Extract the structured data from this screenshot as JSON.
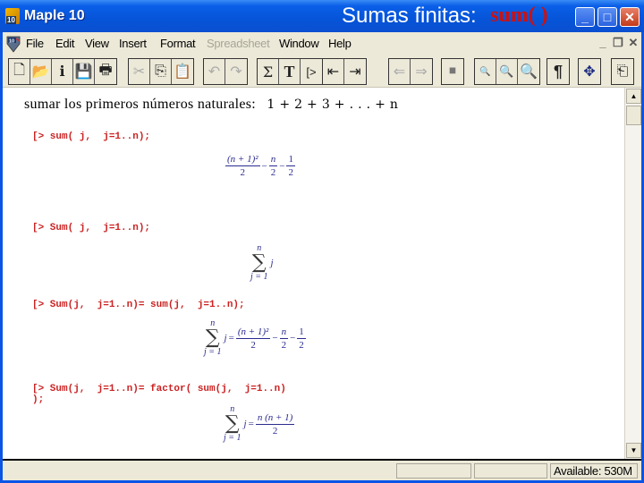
{
  "window": {
    "app_title": "Maple 10",
    "app_icon_label": "10",
    "slide_title": "Sumas finitas:",
    "slide_title_code": "sum( )",
    "controls": {
      "minimize": "_",
      "maximize": "□",
      "close": "✕"
    }
  },
  "menubar": {
    "items": [
      {
        "label": "File",
        "enabled": true
      },
      {
        "label": "Edit",
        "enabled": true
      },
      {
        "label": "View",
        "enabled": true
      },
      {
        "label": "Insert",
        "enabled": true
      },
      {
        "label": "Format",
        "enabled": true
      },
      {
        "label": "Spreadsheet",
        "enabled": false
      },
      {
        "label": "Window",
        "enabled": true
      },
      {
        "label": "Help",
        "enabled": true
      }
    ],
    "doc_controls": {
      "minimize": "_",
      "restore": "❐",
      "close": "✕"
    }
  },
  "toolbar": {
    "groups": [
      [
        {
          "icon": "new-document-icon",
          "glyph": "🗋"
        },
        {
          "icon": "open-folder-icon",
          "glyph": "📂"
        },
        {
          "icon": "document-info-icon",
          "glyph": "ℹ"
        },
        {
          "icon": "save-icon",
          "glyph": "💾"
        },
        {
          "icon": "print-icon",
          "glyph": "🖶"
        }
      ],
      [
        {
          "icon": "cut-icon",
          "glyph": "✂",
          "enabled": false
        },
        {
          "icon": "copy-icon",
          "glyph": "⎘"
        },
        {
          "icon": "paste-icon",
          "glyph": "📋"
        }
      ],
      [
        {
          "icon": "undo-icon",
          "glyph": "↶",
          "enabled": false
        },
        {
          "icon": "redo-icon",
          "glyph": "↷",
          "enabled": false
        }
      ],
      [
        {
          "icon": "sigma-math-icon",
          "glyph": "Σ"
        },
        {
          "icon": "text-T-icon",
          "glyph": "T"
        },
        {
          "icon": "execution-group-icon",
          "glyph": "[>"
        }
      ],
      [
        {
          "icon": "outdent-icon",
          "glyph": "⇤"
        },
        {
          "icon": "indent-icon",
          "glyph": "⇥"
        }
      ],
      [
        {
          "icon": "back-arrow-icon",
          "glyph": "⇐"
        },
        {
          "icon": "forward-arrow-icon",
          "glyph": "⇒"
        }
      ],
      [
        {
          "icon": "stop-icon",
          "glyph": "⏹"
        }
      ],
      [
        {
          "icon": "zoom-small-icon",
          "glyph": "🔍"
        },
        {
          "icon": "zoom-medium-icon",
          "glyph": "🔍"
        },
        {
          "icon": "zoom-large-icon",
          "glyph": "🔍"
        }
      ],
      [
        {
          "icon": "pilcrow-icon",
          "glyph": "¶"
        }
      ],
      [
        {
          "icon": "move-arrows-icon",
          "glyph": "✥"
        }
      ],
      [
        {
          "icon": "restart-icon",
          "glyph": "⎗"
        }
      ]
    ]
  },
  "document": {
    "heading_text": "sumar los primeros números naturales:",
    "heading_math": "1 + 2 + 3 + . . . + n",
    "blocks": [
      {
        "command": "[> sum( j,  j=1..n);",
        "output": {
          "type": "closed-form",
          "num": "(n + 1)²",
          "den": "2",
          "terms": [
            "n/2",
            "1/2"
          ]
        }
      },
      {
        "command": "[> Sum( j,  j=1..n);",
        "output": {
          "type": "sigma",
          "upper": "n",
          "lower": "j = 1",
          "summand": "j"
        }
      },
      {
        "command": "[> Sum(j,  j=1..n)= sum(j,  j=1..n);",
        "output": {
          "type": "sigma-eq-closed",
          "upper": "n",
          "lower": "j = 1",
          "summand": "j",
          "rhs_num": "(n + 1)²",
          "rhs_den": "2"
        }
      },
      {
        "command": "[> Sum(j,  j=1..n)= factor( sum(j,  j=1..n)\n);",
        "output": {
          "type": "sigma-eq-factored",
          "upper": "n",
          "lower": "j = 1",
          "summand": "j",
          "rhs_num": "n (n + 1)",
          "rhs_den": "2"
        }
      }
    ]
  },
  "statusbar": {
    "panels": [
      "",
      "",
      ""
    ],
    "memory": "Available: 530M"
  }
}
